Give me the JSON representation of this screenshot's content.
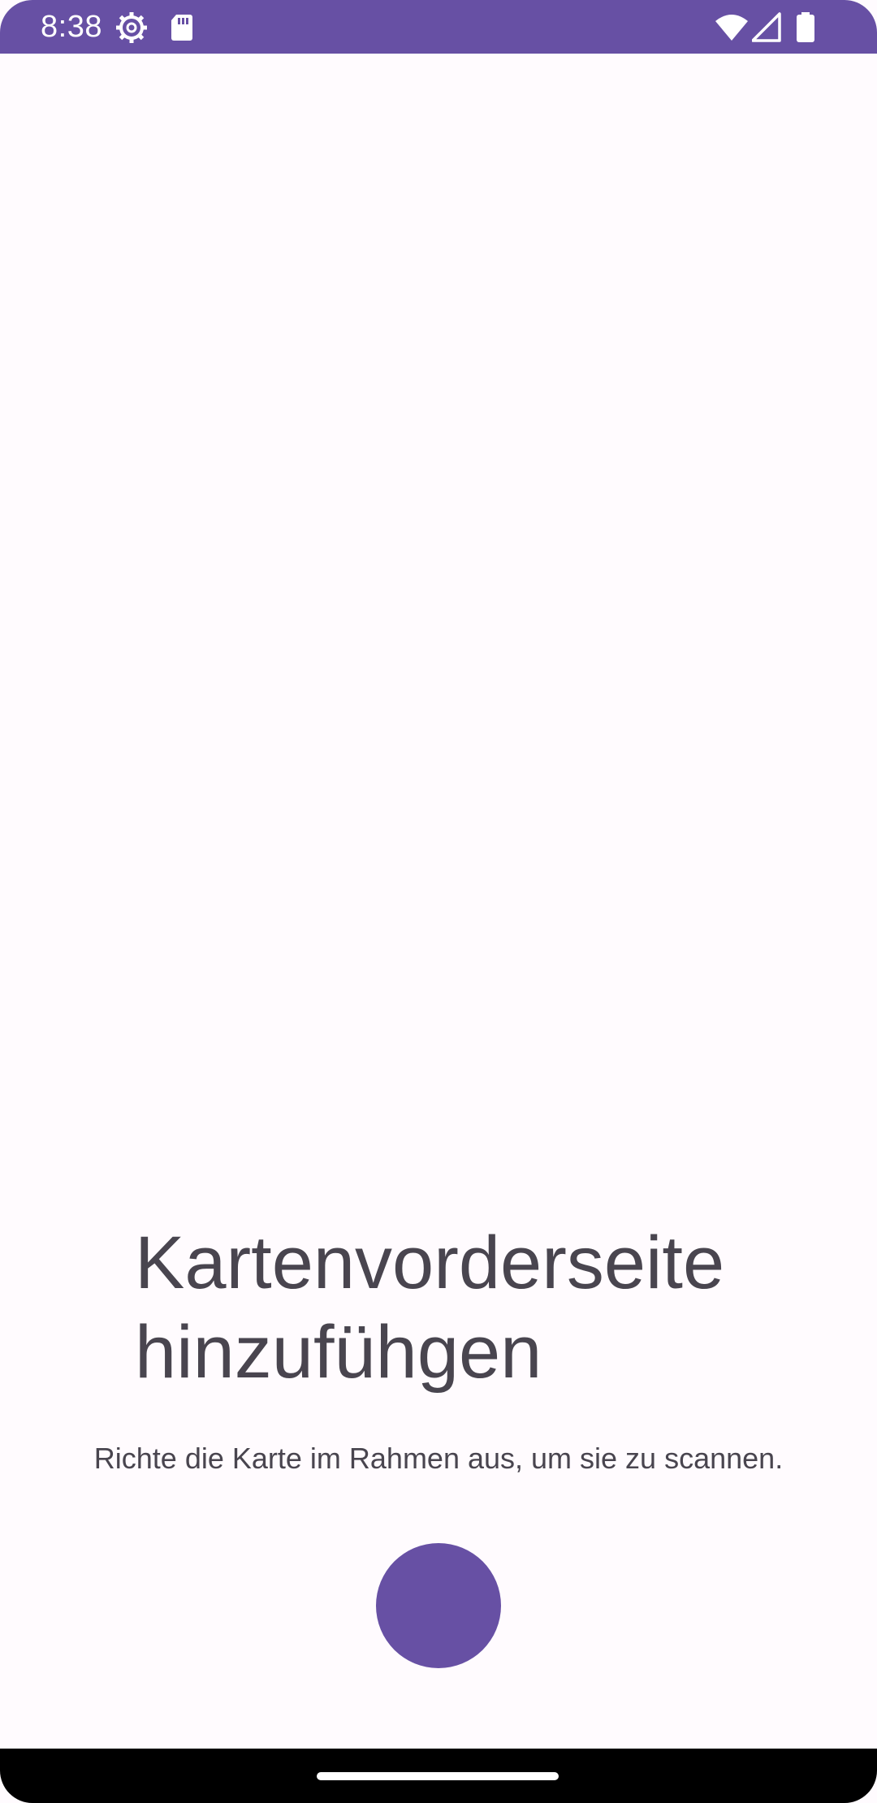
{
  "status_bar": {
    "time": "8:38",
    "background_color": "#6750a4",
    "left_icons": [
      "settings-gear-icon",
      "sd-card-icon"
    ],
    "right_icons": [
      "wifi-icon",
      "cell-signal-icon",
      "battery-icon"
    ]
  },
  "scan": {
    "title": "Kartenvorderseite\nhinzufühgen",
    "instruction": "Richte die Karte im Rahmen aus, um sie zu scannen."
  },
  "colors": {
    "accent": "#6750a4",
    "background": "#fffbfe",
    "text": "#49454f"
  },
  "nav_bar": {
    "handle_icon": "home-gesture-handle"
  }
}
